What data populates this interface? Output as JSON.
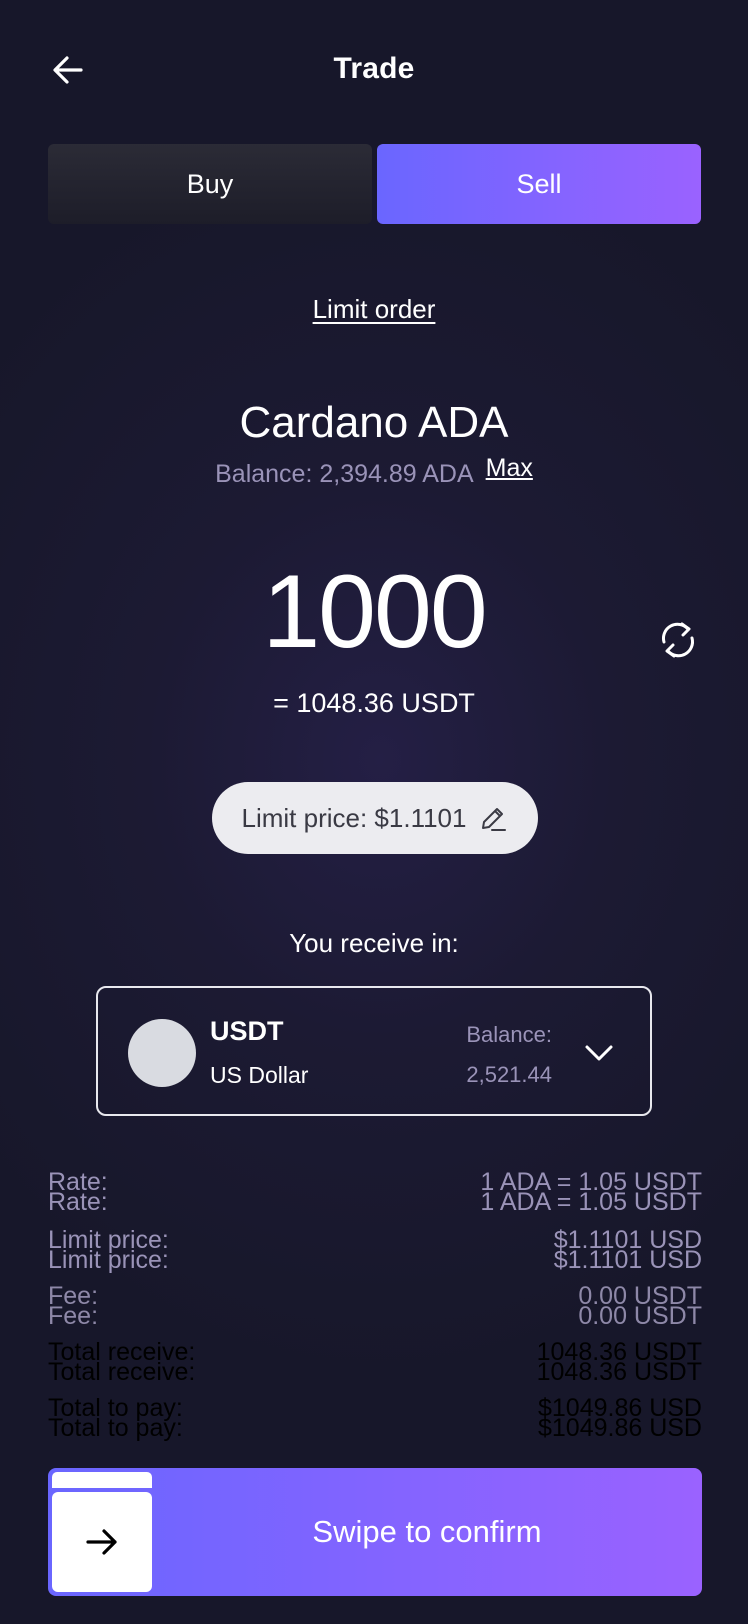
{
  "header": {
    "title": "Trade",
    "back_icon": "arrow-left-icon"
  },
  "tabs": [
    {
      "label": "Buy",
      "active": false
    },
    {
      "label": "Sell",
      "active": true
    }
  ],
  "order_type": "Limit order",
  "asset": {
    "name": "Cardano ADA",
    "balance": "Balance: 2,394.89 ADA",
    "max_label": "Max"
  },
  "amount": {
    "value": "1000",
    "equivalent": "= 1048.36 USDT",
    "swap_icon": "swap-arrows-icon"
  },
  "limit_price": {
    "label": "Limit price: $1.1101",
    "icon": "pencil-edit-icon"
  },
  "receive": {
    "label": "You receive in:",
    "currency_symbol": "USDT",
    "currency_name": "US Dollar",
    "balance_label": "Balance:",
    "balance_value": "2,521.44",
    "chevron_icon": "chevron-down-icon"
  },
  "summary": [
    {
      "label": "Rate:",
      "value": "1 ADA = 1.05 USDT",
      "color": "#9a93b8"
    },
    {
      "label": "Limit price:",
      "value": "$1.1101 USD",
      "color": "#9a93b8"
    },
    {
      "label": "Fee:",
      "value": "0.00 USDT",
      "color": "#8e88a8"
    },
    {
      "label": "Total receive:",
      "value": "1048.36 USDT",
      "color": "#000000"
    },
    {
      "label": "Total to pay:",
      "value": "$1049.86 USD",
      "color": "#000000"
    }
  ],
  "confirm": {
    "label": "Swipe to confirm",
    "thumb_icon": "arrow-right-icon"
  },
  "colors": {
    "accent_start": "#6a66ff",
    "accent_end": "#9a62ff",
    "muted_text": "#9a93b8"
  }
}
